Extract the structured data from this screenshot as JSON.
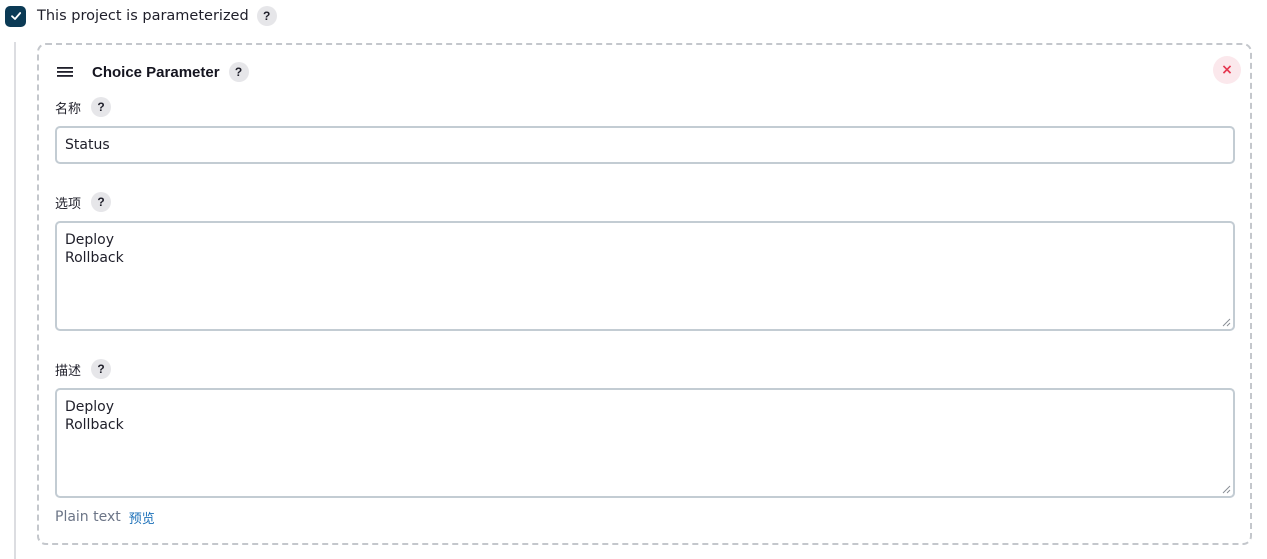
{
  "parameterized": {
    "label": "This project is parameterized",
    "checked": true,
    "help": "?"
  },
  "choice_parameter": {
    "title": "Choice Parameter",
    "help": "?",
    "close_label": "×",
    "fields": {
      "name": {
        "label": "名称",
        "help": "?",
        "value": "Status"
      },
      "choices": {
        "label": "选项",
        "help": "?",
        "lines": [
          "Deploy",
          "Rollback"
        ]
      },
      "description": {
        "label": "描述",
        "help": "?",
        "lines": [
          "Deploy",
          "Rollback"
        ]
      }
    },
    "footer": {
      "plain_text": "Plain text",
      "preview": "预览"
    }
  },
  "colors": {
    "checkbox": "#0b3a55",
    "link": "#1a6fb8",
    "close": "#e5364f"
  },
  "icons": [
    "check-icon",
    "help-icon",
    "drag-handle-icon",
    "close-icon",
    "resize-grip-icon"
  ]
}
